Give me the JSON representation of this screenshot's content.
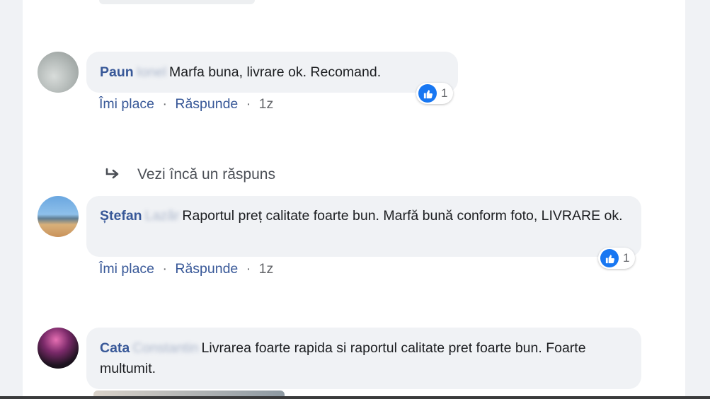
{
  "comments": [
    {
      "author": "Paun",
      "author_hidden": "Ionel",
      "text": "Marfa buna, livrare ok. Recomand.",
      "like_label": "Îmi place",
      "reply_label": "Răspunde",
      "age": "1z",
      "reactions": "1"
    },
    {
      "author": "Ștefan",
      "author_hidden": "Lazăr",
      "text": "Raportul preț calitate foarte bun. Marfă bună conform foto, LIVRARE ok.",
      "like_label": "Îmi place",
      "reply_label": "Răspunde",
      "age": "1z",
      "reactions": "1"
    },
    {
      "author": "Cata",
      "author_hidden": "Constantin",
      "text": "Livrarea foarte rapida si raportul calitate pret foarte bun. Foarte multumit."
    }
  ],
  "more_replies": "Vezi încă un răspuns",
  "separator": "·",
  "colors": {
    "author": "#385898",
    "bubble": "#f0f2f5",
    "like": "#1877f2",
    "meta": "#65676b"
  },
  "icons": {
    "like": "thumbs-up-icon",
    "reply": "reply-arrow-icon"
  }
}
